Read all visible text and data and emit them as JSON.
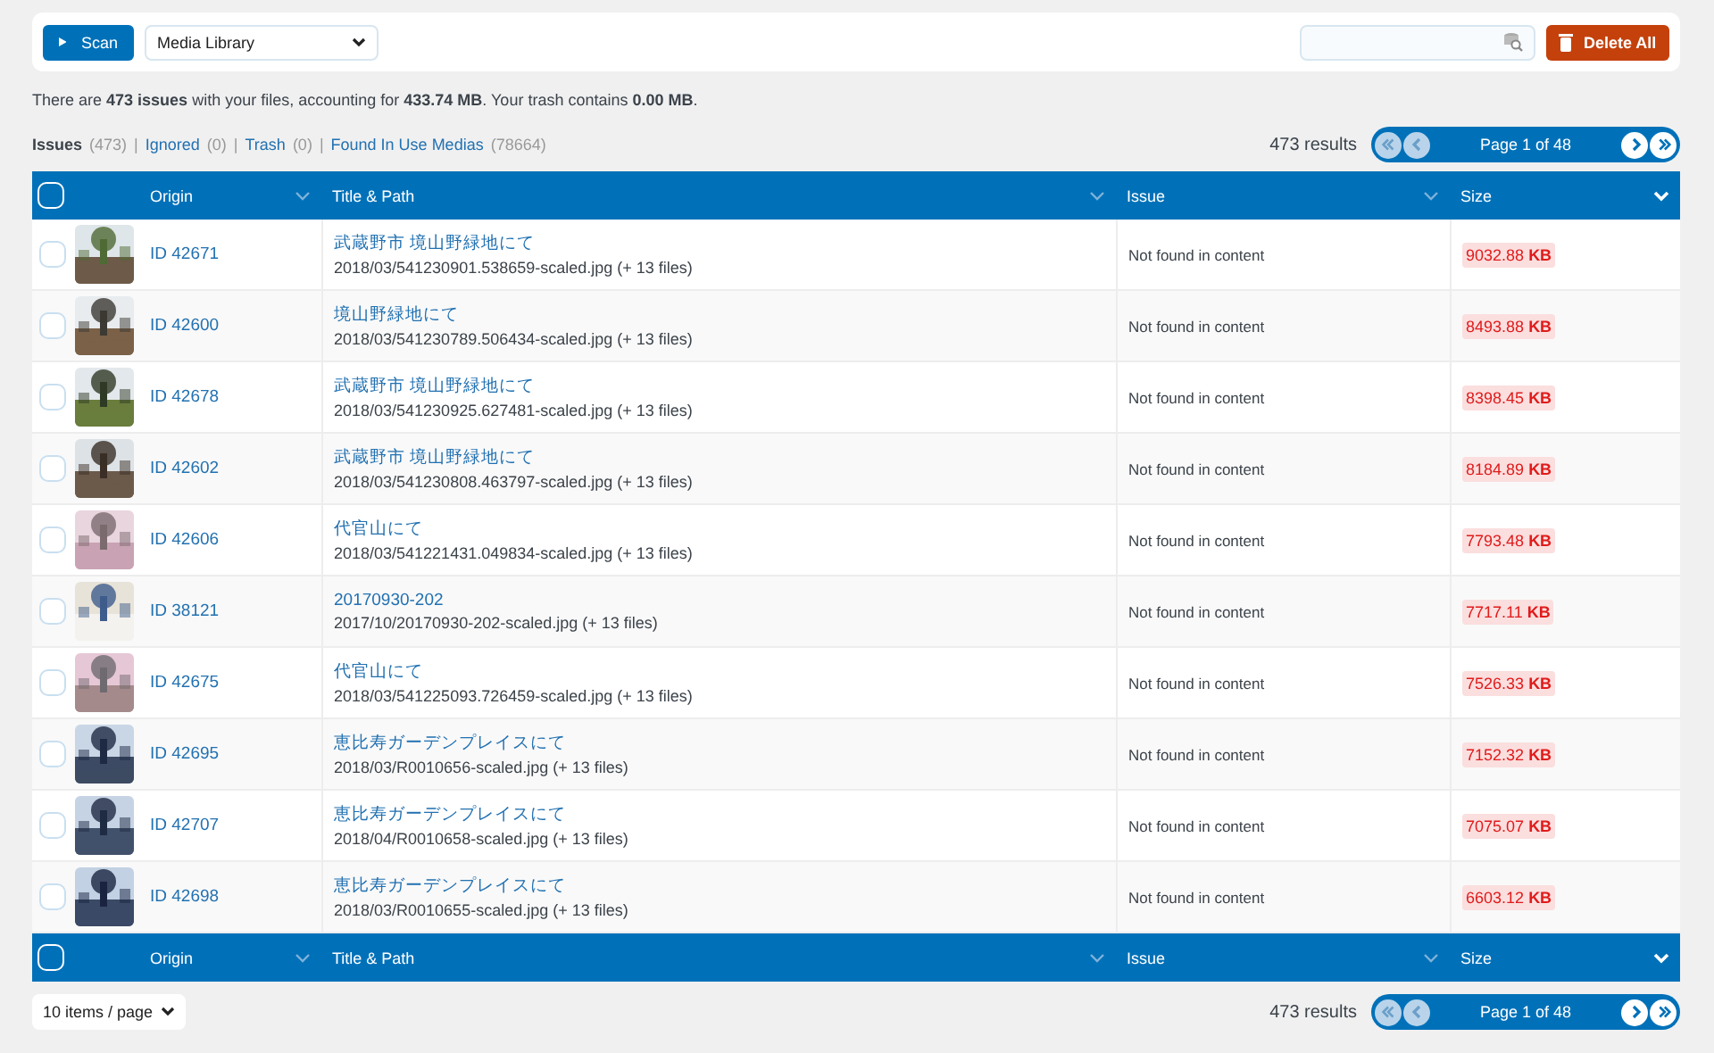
{
  "toolbar": {
    "scan_label": "Scan",
    "source": "Media Library",
    "delete_label": "Delete All"
  },
  "summary": "There are **473 issues** with your files, accounting for **433.74 MB**. Your trash contains **0.00 MB**.",
  "tabs": [
    {
      "label": "Issues",
      "count": "(473)",
      "selected": true
    },
    {
      "separator": "|",
      "label": "Ignored",
      "count": "(0)",
      "selected": false
    },
    {
      "separator": "|",
      "label": "Trash",
      "count": "(0)",
      "selected": false
    },
    {
      "separator": "|",
      "label": "Found In Use Medias",
      "count": "(78664)",
      "selected": false
    }
  ],
  "pagination_top": {
    "results": "473 results",
    "page": "Page 1 of 48",
    "first_disabled": true,
    "prev_disabled": true,
    "next_disabled": false,
    "last_disabled": false
  },
  "table": {
    "header": {
      "checked": false,
      "columns": [
        {
          "label": "Origin",
          "sorted": false
        },
        {
          "label": "Title & Path",
          "sorted": false
        },
        {
          "label": "Issue",
          "sorted": false
        },
        {
          "label": "Size",
          "sorted": true
        }
      ]
    },
    "rows": [
      {
        "checked": false,
        "origin": "ID 42671",
        "title": "武蔵野市 境山野緑地にて",
        "path": "2018/03/541230901.538659-scaled.jpg (+ 13 files)",
        "issue": "Not found in content",
        "size": "9032.88 KB"
      },
      {
        "checked": false,
        "origin": "ID 42600",
        "title": "境山野緑地にて",
        "path": "2018/03/541230789.506434-scaled.jpg (+ 13 files)",
        "issue": "Not found in content",
        "size": "8493.88 KB"
      },
      {
        "checked": false,
        "origin": "ID 42678",
        "title": "武蔵野市 境山野緑地にて",
        "path": "2018/03/541230925.627481-scaled.jpg (+ 13 files)",
        "issue": "Not found in content",
        "size": "8398.45 KB"
      },
      {
        "checked": false,
        "origin": "ID 42602",
        "title": "武蔵野市 境山野緑地にて",
        "path": "2018/03/541230808.463797-scaled.jpg (+ 13 files)",
        "issue": "Not found in content",
        "size": "8184.89 KB"
      },
      {
        "checked": false,
        "origin": "ID 42606",
        "title": "代官山にて",
        "path": "2018/03/541221431.049834-scaled.jpg (+ 13 files)",
        "issue": "Not found in content",
        "size": "7793.48 KB"
      },
      {
        "checked": false,
        "origin": "ID 38121",
        "title": "20170930-202",
        "path": "2017/10/20170930-202-scaled.jpg (+ 13 files)",
        "issue": "Not found in content",
        "size": "7717.11 KB"
      },
      {
        "checked": false,
        "origin": "ID 42675",
        "title": "代官山にて",
        "path": "2018/03/541225093.726459-scaled.jpg (+ 13 files)",
        "issue": "Not found in content",
        "size": "7526.33 KB"
      },
      {
        "checked": false,
        "origin": "ID 42695",
        "title": "恵比寿ガーデンプレイスにて",
        "path": "2018/03/R0010656-scaled.jpg (+ 13 files)",
        "issue": "Not found in content",
        "size": "7152.32 KB"
      },
      {
        "checked": false,
        "origin": "ID 42707",
        "title": "恵比寿ガーデンプレイスにて",
        "path": "2018/04/R0010658-scaled.jpg (+ 13 files)",
        "issue": "Not found in content",
        "size": "7075.07 KB"
      },
      {
        "checked": false,
        "origin": "ID 42698",
        "title": "恵比寿ガーデンプレイスにて",
        "path": "2018/03/R0010655-scaled.jpg (+ 13 files)",
        "issue": "Not found in content",
        "size": "6603.12 KB"
      }
    ],
    "footer": {
      "checked": false,
      "columns": [
        {
          "label": "Origin",
          "sorted": false
        },
        {
          "label": "Title & Path",
          "sorted": false
        },
        {
          "label": "Issue",
          "sorted": false
        },
        {
          "label": "Size",
          "sorted": true
        }
      ]
    }
  },
  "per_page": "10 items / page",
  "pagination_bottom": {
    "results": "473 results",
    "page": "Page 1 of 48",
    "first_disabled": true,
    "prev_disabled": true,
    "next_disabled": false,
    "last_disabled": false
  }
}
